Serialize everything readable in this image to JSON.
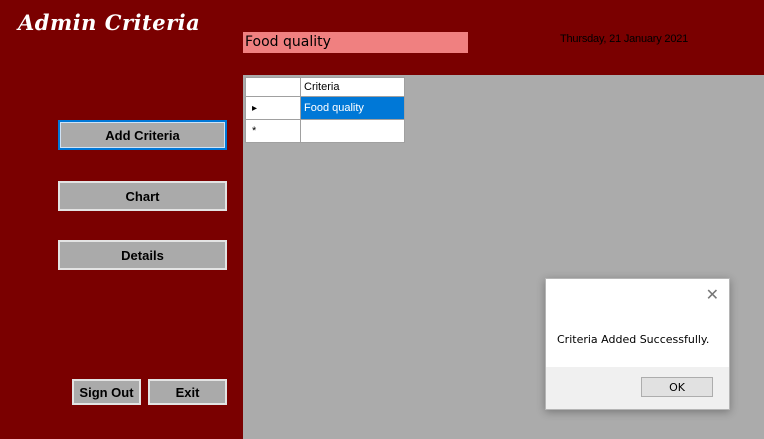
{
  "window": {
    "title": "Admin Criteria"
  },
  "header": {
    "criteria_value": "Food quality",
    "date": "Thursday, 21 January 2021"
  },
  "nav": {
    "add_criteria": "Add Criteria",
    "chart": "Chart",
    "details": "Details",
    "sign_out": "Sign Out",
    "exit": "Exit"
  },
  "grid": {
    "column_header": "Criteria",
    "rows": [
      {
        "marker": "▸",
        "value": "Food quality"
      },
      {
        "marker": "*",
        "value": ""
      }
    ]
  },
  "dialog": {
    "message": "Criteria Added Successfully.",
    "ok_label": "OK",
    "close_icon": "✕"
  },
  "colors": {
    "background": "#7a0000",
    "input_bg": "#f08080",
    "grid_bg": "#ababab",
    "selection": "#0078d7"
  }
}
